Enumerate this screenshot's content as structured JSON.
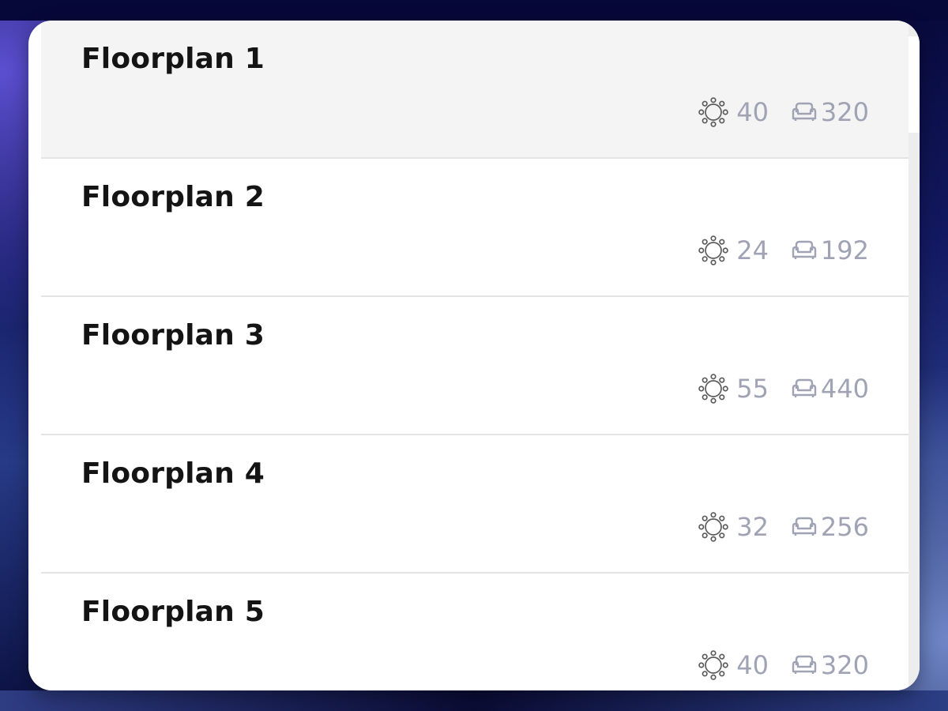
{
  "floorplans": [
    {
      "name": "Floorplan 1",
      "tables": "40",
      "seats": "320",
      "selected": true
    },
    {
      "name": "Floorplan 2",
      "tables": "24",
      "seats": "192",
      "selected": false
    },
    {
      "name": "Floorplan 3",
      "tables": "55",
      "seats": "440",
      "selected": false
    },
    {
      "name": "Floorplan 4",
      "tables": "32",
      "seats": "256",
      "selected": false
    },
    {
      "name": "Floorplan 5",
      "tables": "40",
      "seats": "320",
      "selected": false
    }
  ],
  "icons": {
    "tables": "round-table-icon",
    "seats": "armchair-icon"
  },
  "colors": {
    "title": "#141414",
    "meta": "#a0a3b4",
    "selected_row": "#f4f4f4",
    "divider": "#e4e4e4"
  }
}
